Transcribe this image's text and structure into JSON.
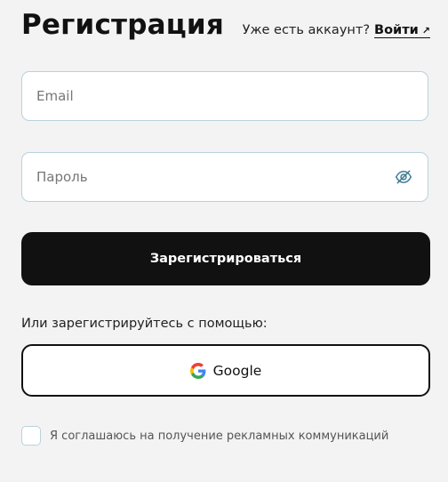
{
  "header": {
    "title": "Регистрация",
    "login_prompt": "Уже есть аккаунт?",
    "login_link": "Войти",
    "login_link_icon": "arrow-up-right-icon"
  },
  "form": {
    "email": {
      "placeholder": "Email",
      "value": ""
    },
    "password": {
      "placeholder": "Пароль",
      "value": "",
      "toggle_icon": "eye-off-icon"
    },
    "submit_label": "Зарегистрироваться"
  },
  "social": {
    "prompt": "Или зарегистрируйтесь с помощью:",
    "google_label": "Google",
    "google_icon": "google-icon"
  },
  "consent": {
    "checked": false,
    "label": "Я соглашаюсь на получение рекламных коммуникаций"
  },
  "colors": {
    "background": "#f3f3f3",
    "primary_button": "#111111",
    "field_border": "#b9d2dc",
    "eye_icon": "#3f7c95"
  }
}
